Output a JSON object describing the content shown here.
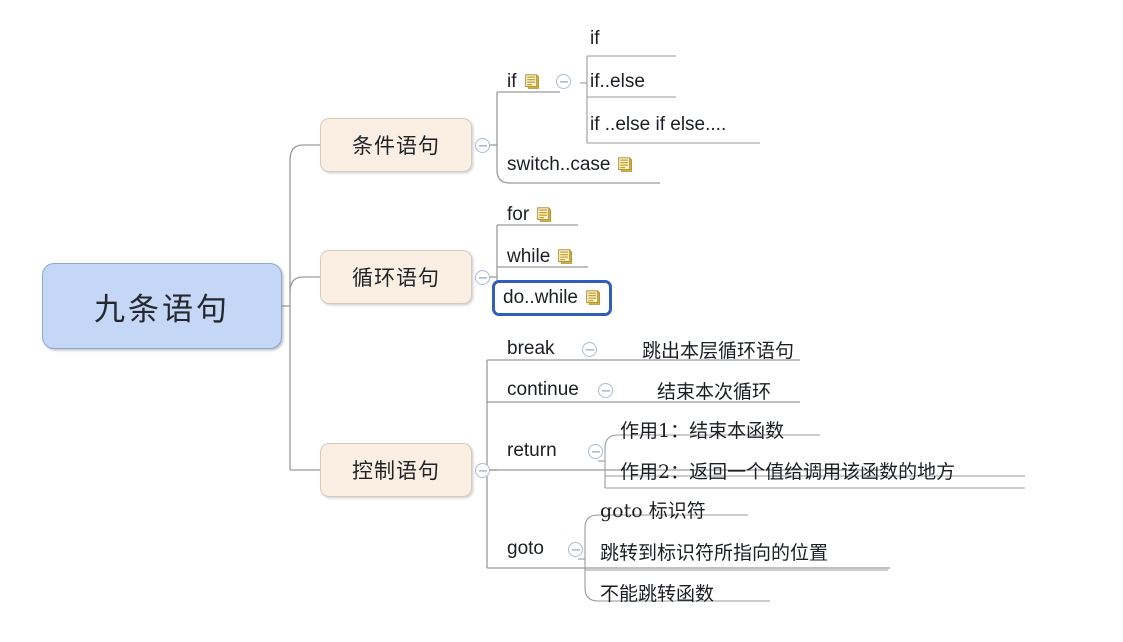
{
  "diagram": {
    "type": "mind-map",
    "title": "九条语句",
    "colors": {
      "root_fill": "#c4d7f6",
      "root_border": "#8aa9d8",
      "branch_fill": "#fbeee3",
      "branch_border": "#d8cbbd",
      "connector": "#9a9a9a",
      "selection": "#2f5fb8",
      "note_icon": "#c9a227",
      "collapse_icon": "#a8bcd8"
    },
    "root": {
      "label": "九条语句"
    },
    "branches": [
      {
        "label": "条件语句",
        "children": [
          {
            "label": "if",
            "has_note": true,
            "has_collapse": true,
            "children": [
              {
                "label": "if"
              },
              {
                "label": "if..else"
              },
              {
                "label": "if ..else if else...."
              }
            ]
          },
          {
            "label": "switch..case",
            "has_note": true,
            "children": []
          }
        ]
      },
      {
        "label": "循环语句",
        "children": [
          {
            "label": "for",
            "has_note": true,
            "children": []
          },
          {
            "label": "while",
            "has_note": true,
            "children": []
          },
          {
            "label": "do..while",
            "has_note": true,
            "selected": true,
            "children": []
          }
        ]
      },
      {
        "label": "控制语句",
        "children": [
          {
            "label": "break",
            "has_collapse": true,
            "children": [
              {
                "label": "跳出本层循环语句"
              }
            ]
          },
          {
            "label": "continue",
            "has_collapse": true,
            "children": [
              {
                "label": "结束本次循环"
              }
            ]
          },
          {
            "label": "return",
            "has_collapse": true,
            "children": [
              {
                "label": "作用1：结束本函数"
              },
              {
                "label": "作用2：返回一个值给调用该函数的地方"
              }
            ]
          },
          {
            "label": "goto",
            "has_collapse": true,
            "children": [
              {
                "label": "goto 标识符"
              },
              {
                "label": "跳转到标识符所指向的位置"
              },
              {
                "label": "不能跳转函数"
              }
            ]
          }
        ]
      }
    ],
    "icons": {
      "note": "note-icon",
      "collapse": "collapse-minus-icon"
    }
  }
}
